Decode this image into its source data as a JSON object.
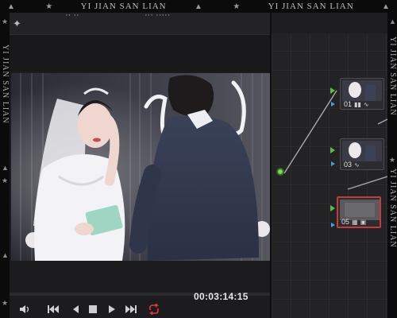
{
  "watermark": {
    "text": "YI JIAN SAN LIAN"
  },
  "viewer": {
    "toolbar_text_left": "·· ··",
    "toolbar_text_right": "··· ·····",
    "timecode": "00:03:14:15"
  },
  "transport": {
    "volume_icon": "speaker-icon",
    "buttons": [
      "skip-back-icon",
      "step-back-icon",
      "stop-icon",
      "play-icon",
      "skip-forward-icon",
      "loop-icon"
    ]
  },
  "node_graph": {
    "nodes": [
      {
        "id": "01",
        "label": "01",
        "selected": false
      },
      {
        "id": "03",
        "label": "03",
        "selected": false
      },
      {
        "id": "05",
        "label": "05",
        "selected": true
      }
    ]
  },
  "colors": {
    "loop_active": "#e03a3a",
    "node_selected_border": "#c73a3a",
    "port_green": "#55c23b",
    "port_blue": "#3aa3e6"
  }
}
